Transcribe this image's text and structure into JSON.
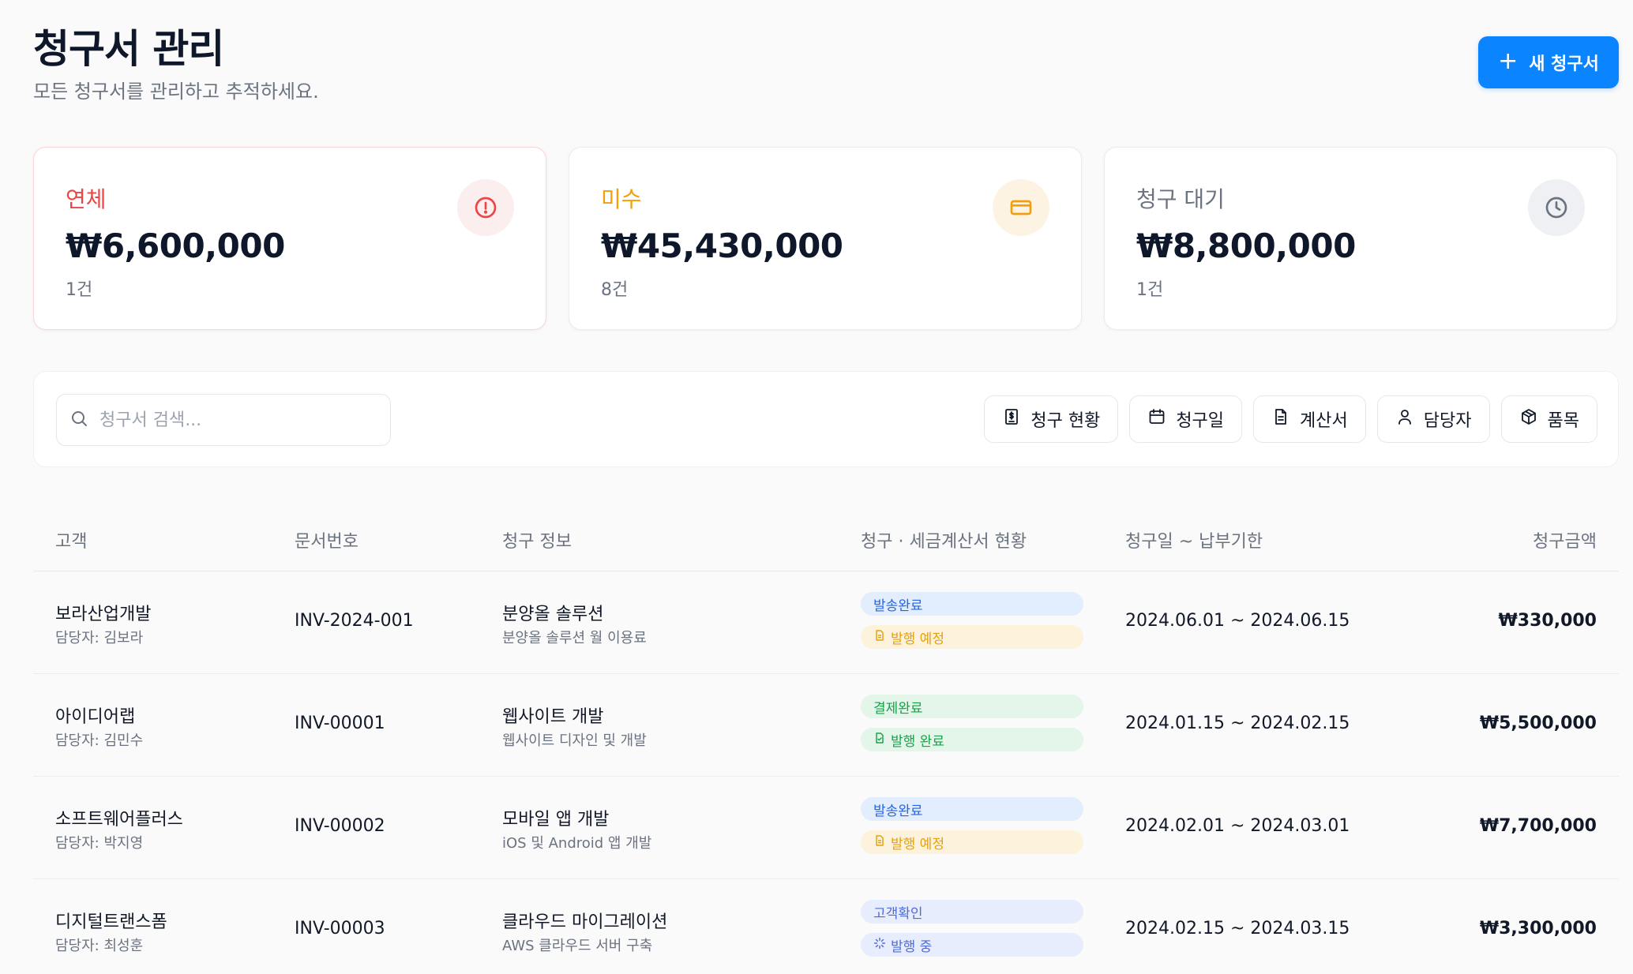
{
  "header": {
    "title": "청구서 관리",
    "subtitle": "모든 청구서를 관리하고 추적하세요.",
    "new_invoice_label": "새 청구서",
    "new_invoice_icon": "plus-icon",
    "accent": "#0a84ff"
  },
  "summary": [
    {
      "label": "연체",
      "amount": "₩6,600,000",
      "count": "1건",
      "icon": "alert-circle-icon",
      "color": "#ef4444"
    },
    {
      "label": "미수",
      "amount": "₩45,430,000",
      "count": "8건",
      "icon": "credit-card-icon",
      "color": "#f59e0b"
    },
    {
      "label": "청구 대기",
      "amount": "₩8,800,000",
      "count": "1건",
      "icon": "clock-icon",
      "color": "#6b7280"
    }
  ],
  "search": {
    "placeholder": "청구서 검색...",
    "value": "",
    "icon": "search-icon"
  },
  "filters": [
    {
      "label": "청구 현황",
      "icon": "invoice-dollar-icon"
    },
    {
      "label": "청구일",
      "icon": "calendar-icon"
    },
    {
      "label": "계산서",
      "icon": "document-icon"
    },
    {
      "label": "담당자",
      "icon": "user-icon"
    },
    {
      "label": "품목",
      "icon": "package-icon"
    }
  ],
  "table": {
    "columns": [
      "고객",
      "문서번호",
      "청구 정보",
      "청구 · 세금계산서 현황",
      "청구일 ~ 납부기한",
      "청구금액"
    ],
    "rows": [
      {
        "client": "보라산업개발",
        "manager": "담당자: 김보라",
        "doc_no": "INV-2024-001",
        "title": "분양올 솔루션",
        "desc": "분양올 솔루션 월 이용료",
        "billing_status": "발송완료",
        "billing_kind": "sent",
        "tax_status": "발행 예정",
        "tax_kind": "planned",
        "date_range": "2024.06.01 ~ 2024.06.15",
        "amount": "₩330,000"
      },
      {
        "client": "아이디어랩",
        "manager": "담당자: 김민수",
        "doc_no": "INV-00001",
        "title": "웹사이트 개발",
        "desc": "웹사이트 디자인 및 개발",
        "billing_status": "결제완료",
        "billing_kind": "paid",
        "tax_status": "발행 완료",
        "tax_kind": "done",
        "date_range": "2024.01.15 ~ 2024.02.15",
        "amount": "₩5,500,000"
      },
      {
        "client": "소프트웨어플러스",
        "manager": "담당자: 박지영",
        "doc_no": "INV-00002",
        "title": "모바일 앱 개발",
        "desc": "iOS 및 Android 앱 개발",
        "billing_status": "발송완료",
        "billing_kind": "sent",
        "tax_status": "발행 예정",
        "tax_kind": "planned",
        "date_range": "2024.02.01 ~ 2024.03.01",
        "amount": "₩7,700,000"
      },
      {
        "client": "디지털트랜스폼",
        "manager": "담당자: 최성훈",
        "doc_no": "INV-00003",
        "title": "클라우드 마이그레이션",
        "desc": "AWS 클라우드 서버 구축",
        "billing_status": "고객확인",
        "billing_kind": "confirm",
        "tax_status": "발행 중",
        "tax_kind": "progress",
        "date_range": "2024.02.15 ~ 2024.03.15",
        "amount": "₩3,300,000"
      }
    ]
  }
}
